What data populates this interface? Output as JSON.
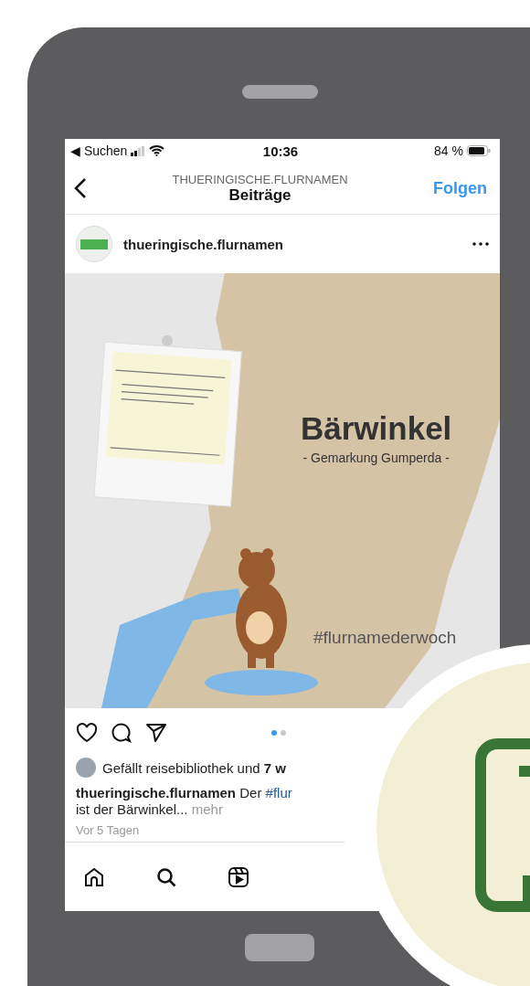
{
  "status_bar": {
    "back_label": "◀ Suchen",
    "time": "10:36",
    "battery": "84 %"
  },
  "header": {
    "account": "THUERINGISCHE.FLURNAMEN",
    "title": "Beiträge",
    "follow": "Folgen"
  },
  "post": {
    "username": "thueringische.flurnamen",
    "image": {
      "title": "Bärwinkel",
      "subtitle": "- Gemarkung Gumperda -",
      "hashtag": "#flurnamederwoch"
    },
    "carousel": [
      {
        "selected": true
      },
      {
        "selected": false
      }
    ],
    "likes": "Gefällt reisebibliothek und **7 w**",
    "caption": {
      "username": "thueringische.flurnamen",
      "text": "Der",
      "hashtag": "#flur",
      "line2": "ist der Bärwinkel...",
      "more": "mehr"
    },
    "date": "Vor 5 Tagen"
  },
  "tab_bar": [
    {
      "kind": "home"
    },
    {
      "kind": "search"
    },
    {
      "kind": "reels"
    }
  ]
}
